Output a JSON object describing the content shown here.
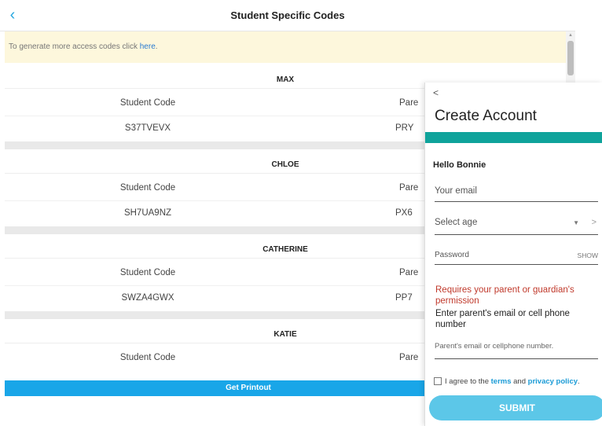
{
  "header": {
    "title": "Student Specific Codes"
  },
  "banner": {
    "text": "To generate more access codes click ",
    "link": "here",
    "suffix": "."
  },
  "students": [
    {
      "name": "MAX",
      "student_label": "Student Code",
      "student_code": "S37TVEVX",
      "parent_label": "Pare",
      "parent_code": "PRY"
    },
    {
      "name": "CHLOE",
      "student_label": "Student Code",
      "student_code": "SH7UA9NZ",
      "parent_label": "Pare",
      "parent_code": "PX6"
    },
    {
      "name": "CATHERINE",
      "student_label": "Student Code",
      "student_code": "SWZA4GWX",
      "parent_label": "Pare",
      "parent_code": "PP7"
    },
    {
      "name": "KATIE",
      "student_label": "Student Code",
      "parent_label": "Pare"
    }
  ],
  "printout": {
    "label": "Get Printout"
  },
  "account": {
    "back": "<",
    "title": "Create Account",
    "greeting": "Hello Bonnie",
    "email_placeholder": "Your email",
    "age_placeholder": "Select age",
    "age_arrow": ">",
    "password_placeholder": "Password",
    "show_label": "SHOW",
    "requirement": "Requires your parent or guardian's permission",
    "enter_prompt": "Enter parent's email or cell phone number",
    "parent_placeholder": "Parent's email or cellphone number.",
    "agree_prefix": "I agree to the ",
    "terms": "terms",
    "and": " and ",
    "privacy": "privacy policy",
    "agree_suffix": ".",
    "submit": "SUBMIT"
  },
  "colors": {
    "accent": "#19a6e8",
    "teal": "#0fa39b",
    "banner_bg": "#fdf7dc",
    "error": "#c0392b",
    "submit_bg": "#5cc7e8"
  },
  "icons": {
    "back": "chevron-left-icon",
    "dropdown": "chevron-down-icon",
    "next": "chevron-right-icon"
  }
}
